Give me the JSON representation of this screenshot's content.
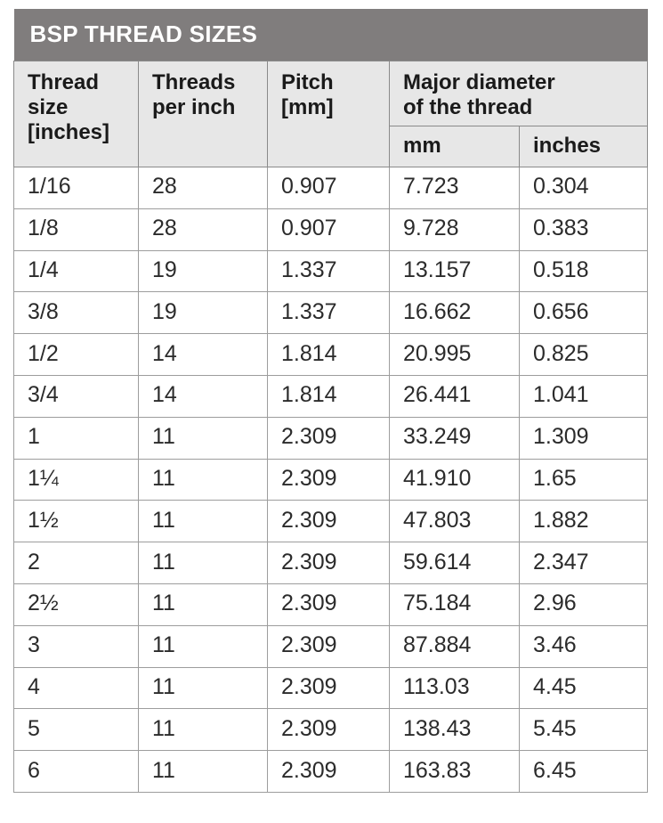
{
  "table": {
    "title": "BSP THREAD SIZES",
    "colors": {
      "title_bar": "#807D7D",
      "title_text": "#FFFFFF",
      "header_bg": "#E7E7E7",
      "header_border": "#8A8A8A",
      "body_bg": "#FFFFFF",
      "body_border": "#9D9D9D",
      "body_text": "#2B2B2B"
    },
    "headers": {
      "thread_size": "Thread size [inches]",
      "thread_size_line1": "Thread",
      "thread_size_line2": "size",
      "thread_size_line3": "[inches]",
      "threads_per_inch_line1": "Threads",
      "threads_per_inch_line2": "per inch",
      "pitch_line1": "Pitch",
      "pitch_line2": "[mm]",
      "major_diameter_line1": "Major diameter",
      "major_diameter_line2": "of the thread",
      "major_diameter_mm": "mm",
      "major_diameter_inches": "inches"
    },
    "columns": [
      "Thread size [inches]",
      "Threads per inch",
      "Pitch [mm]",
      "Major diameter of the thread - mm",
      "Major diameter of the thread - inches"
    ],
    "rows": [
      {
        "thread_size": "1/16",
        "threads_per_inch": "28",
        "pitch_mm": "0.907",
        "major_mm": "7.723",
        "major_in": "0.304"
      },
      {
        "thread_size": "1/8",
        "threads_per_inch": "28",
        "pitch_mm": "0.907",
        "major_mm": "9.728",
        "major_in": "0.383"
      },
      {
        "thread_size": "1/4",
        "threads_per_inch": "19",
        "pitch_mm": "1.337",
        "major_mm": "13.157",
        "major_in": "0.518"
      },
      {
        "thread_size": "3/8",
        "threads_per_inch": "19",
        "pitch_mm": "1.337",
        "major_mm": "16.662",
        "major_in": "0.656"
      },
      {
        "thread_size": "1/2",
        "threads_per_inch": "14",
        "pitch_mm": "1.814",
        "major_mm": "20.995",
        "major_in": "0.825"
      },
      {
        "thread_size": "3/4",
        "threads_per_inch": "14",
        "pitch_mm": "1.814",
        "major_mm": "26.441",
        "major_in": "1.041"
      },
      {
        "thread_size": "1",
        "threads_per_inch": "11",
        "pitch_mm": "2.309",
        "major_mm": "33.249",
        "major_in": "1.309"
      },
      {
        "thread_size": "1¼",
        "threads_per_inch": "11",
        "pitch_mm": "2.309",
        "major_mm": "41.910",
        "major_in": "1.65"
      },
      {
        "thread_size": "1½",
        "threads_per_inch": "11",
        "pitch_mm": "2.309",
        "major_mm": "47.803",
        "major_in": "1.882"
      },
      {
        "thread_size": "2",
        "threads_per_inch": "11",
        "pitch_mm": "2.309",
        "major_mm": "59.614",
        "major_in": "2.347"
      },
      {
        "thread_size": "2½",
        "threads_per_inch": "11",
        "pitch_mm": "2.309",
        "major_mm": "75.184",
        "major_in": "2.96"
      },
      {
        "thread_size": "3",
        "threads_per_inch": "11",
        "pitch_mm": "2.309",
        "major_mm": "87.884",
        "major_in": "3.46"
      },
      {
        "thread_size": "4",
        "threads_per_inch": "11",
        "pitch_mm": "2.309",
        "major_mm": "113.03",
        "major_in": "4.45"
      },
      {
        "thread_size": "5",
        "threads_per_inch": "11",
        "pitch_mm": "2.309",
        "major_mm": "138.43",
        "major_in": "5.45"
      },
      {
        "thread_size": "6",
        "threads_per_inch": "11",
        "pitch_mm": "2.309",
        "major_mm": "163.83",
        "major_in": "6.45"
      }
    ]
  }
}
